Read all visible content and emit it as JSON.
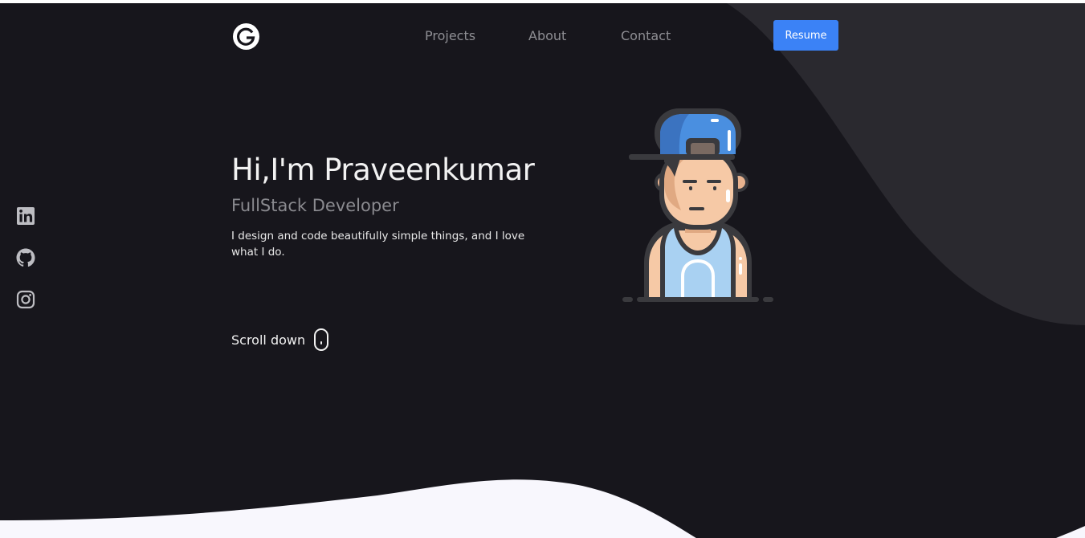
{
  "nav": {
    "logo_letter": "G",
    "links": [
      "Projects",
      "About",
      "Contact"
    ],
    "resume_label": "Resume"
  },
  "social": [
    "linkedin-icon",
    "github-icon",
    "instagram-icon"
  ],
  "hero": {
    "greeting": "Hi,I'm Praveenkumar",
    "role": "FullStack Developer",
    "tagline": "I design and code beautifully simple things, and I love what I do.",
    "scroll_label": "Scroll down"
  },
  "colors": {
    "background": "#17161c",
    "blob": "#2a292f",
    "accent": "#3b82f6",
    "wave": "#f8f7fd"
  }
}
